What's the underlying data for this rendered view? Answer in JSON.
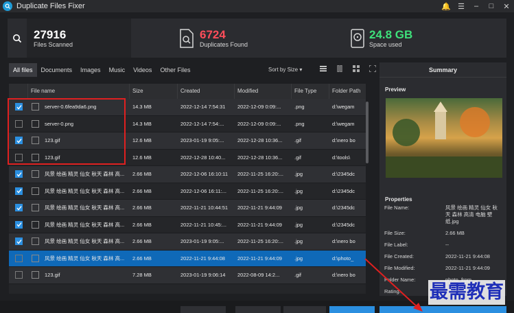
{
  "app": {
    "title": "Duplicate Files Fixer"
  },
  "stats": {
    "scanned": {
      "value": "27916",
      "label": "Files Scanned"
    },
    "duplicates": {
      "value": "6724",
      "label": "Duplicates Found"
    },
    "space": {
      "value": "24.8 GB",
      "label": "Space used"
    }
  },
  "tabs": [
    "All files",
    "Documents",
    "Images",
    "Music",
    "Videos",
    "Other Files"
  ],
  "sort_label": "Sort by Size",
  "columns": [
    "File name",
    "Size",
    "Created",
    "Modified",
    "File Type",
    "Folder Path"
  ],
  "rows": [
    {
      "checked": true,
      "name": "server-0.6fea9da6.png",
      "size": "14.3 MB",
      "created": "2022-12-14 7:54:31",
      "modified": "2022-12-09 0:09:...",
      "type": ".png",
      "path": "d:\\wegam"
    },
    {
      "checked": false,
      "name": "server-0.png",
      "size": "14.3 MB",
      "created": "2022-12-14 7:54:...",
      "modified": "2022-12-09 0:09:...",
      "type": ".png",
      "path": "d:\\wegam"
    },
    {
      "checked": true,
      "name": "123.gif",
      "size": "12.6 MB",
      "created": "2023-01-19 9:05:...",
      "modified": "2022-12-28 10:36...",
      "type": ".gif",
      "path": "d:\\nero bo"
    },
    {
      "checked": false,
      "name": "123.gif",
      "size": "12.6 MB",
      "created": "2022-12-28 10:40...",
      "modified": "2022-12-28 10:36...",
      "type": ".gif",
      "path": "d:\\tools\\"
    },
    {
      "checked": true,
      "name": "风景 绘画 精灵 仙女 秋天 森林 高...",
      "size": "2.66 MB",
      "created": "2022-12-06 16:10:11",
      "modified": "2022-11-25 16:20:...",
      "type": ".jpg",
      "path": "d:\\2345dc"
    },
    {
      "checked": true,
      "name": "风景 绘画 精灵 仙女 秋天 森林 高...",
      "size": "2.66 MB",
      "created": "2022-12-06 16:11:...",
      "modified": "2022-11-25 16:20:...",
      "type": ".jpg",
      "path": "d:\\2345dc"
    },
    {
      "checked": true,
      "name": "风景 绘画 精灵 仙女 秋天 森林 高...",
      "size": "2.66 MB",
      "created": "2022-11-21 10:44:51",
      "modified": "2022-11-21 9:44:09",
      "type": ".jpg",
      "path": "d:\\2345dc"
    },
    {
      "checked": true,
      "name": "风景 绘画 精灵 仙女 秋天 森林 高...",
      "size": "2.66 MB",
      "created": "2022-11-21 10:45:...",
      "modified": "2022-11-21 9:44:09",
      "type": ".jpg",
      "path": "d:\\2345dc"
    },
    {
      "checked": true,
      "name": "风景 绘画 精灵 仙女 秋天 森林 高...",
      "size": "2.66 MB",
      "created": "2023-01-19 9:05:...",
      "modified": "2022-11-25 16:20:...",
      "type": ".jpg",
      "path": "d:\\nero bo"
    },
    {
      "checked": false,
      "name": "风景 绘画 精灵 仙女 秋天 森林 高...",
      "size": "2.66 MB",
      "created": "2022-11-21 9:44:08",
      "modified": "2022-11-21 9:44:09",
      "type": ".jpg",
      "path": "d:\\photo_"
    },
    {
      "checked": false,
      "name": "123.gif",
      "size": "7.28 MB",
      "created": "2023-01-19 9:06:14",
      "modified": "2022-08-09 14:2...",
      "type": ".gif",
      "path": "d:\\nero bo"
    }
  ],
  "panel": {
    "title": "Summary",
    "preview_label": "Preview",
    "properties_label": "Properties",
    "props": [
      {
        "k": "File Name:",
        "v": "风景 绘画 精灵 仙女 秋天 森林 高清 电脑 壁纸.jpg"
      },
      {
        "k": "File Size:",
        "v": "2.66 MB"
      },
      {
        "k": "File Label:",
        "v": "--"
      },
      {
        "k": "File Created:",
        "v": "2022-11-21 9:44:08"
      },
      {
        "k": "File Modified:",
        "v": "2022-11-21 9:44:09"
      },
      {
        "k": "Folder Name:",
        "v": "photo_from_..."
      },
      {
        "k": "Rating:",
        "v": ""
      }
    ]
  },
  "watermark": "最需教育",
  "colors": {
    "accent": "#0f69b8",
    "duplicates": "#ff4d5a",
    "space": "#3ee07a",
    "highlight": "#e02020"
  }
}
